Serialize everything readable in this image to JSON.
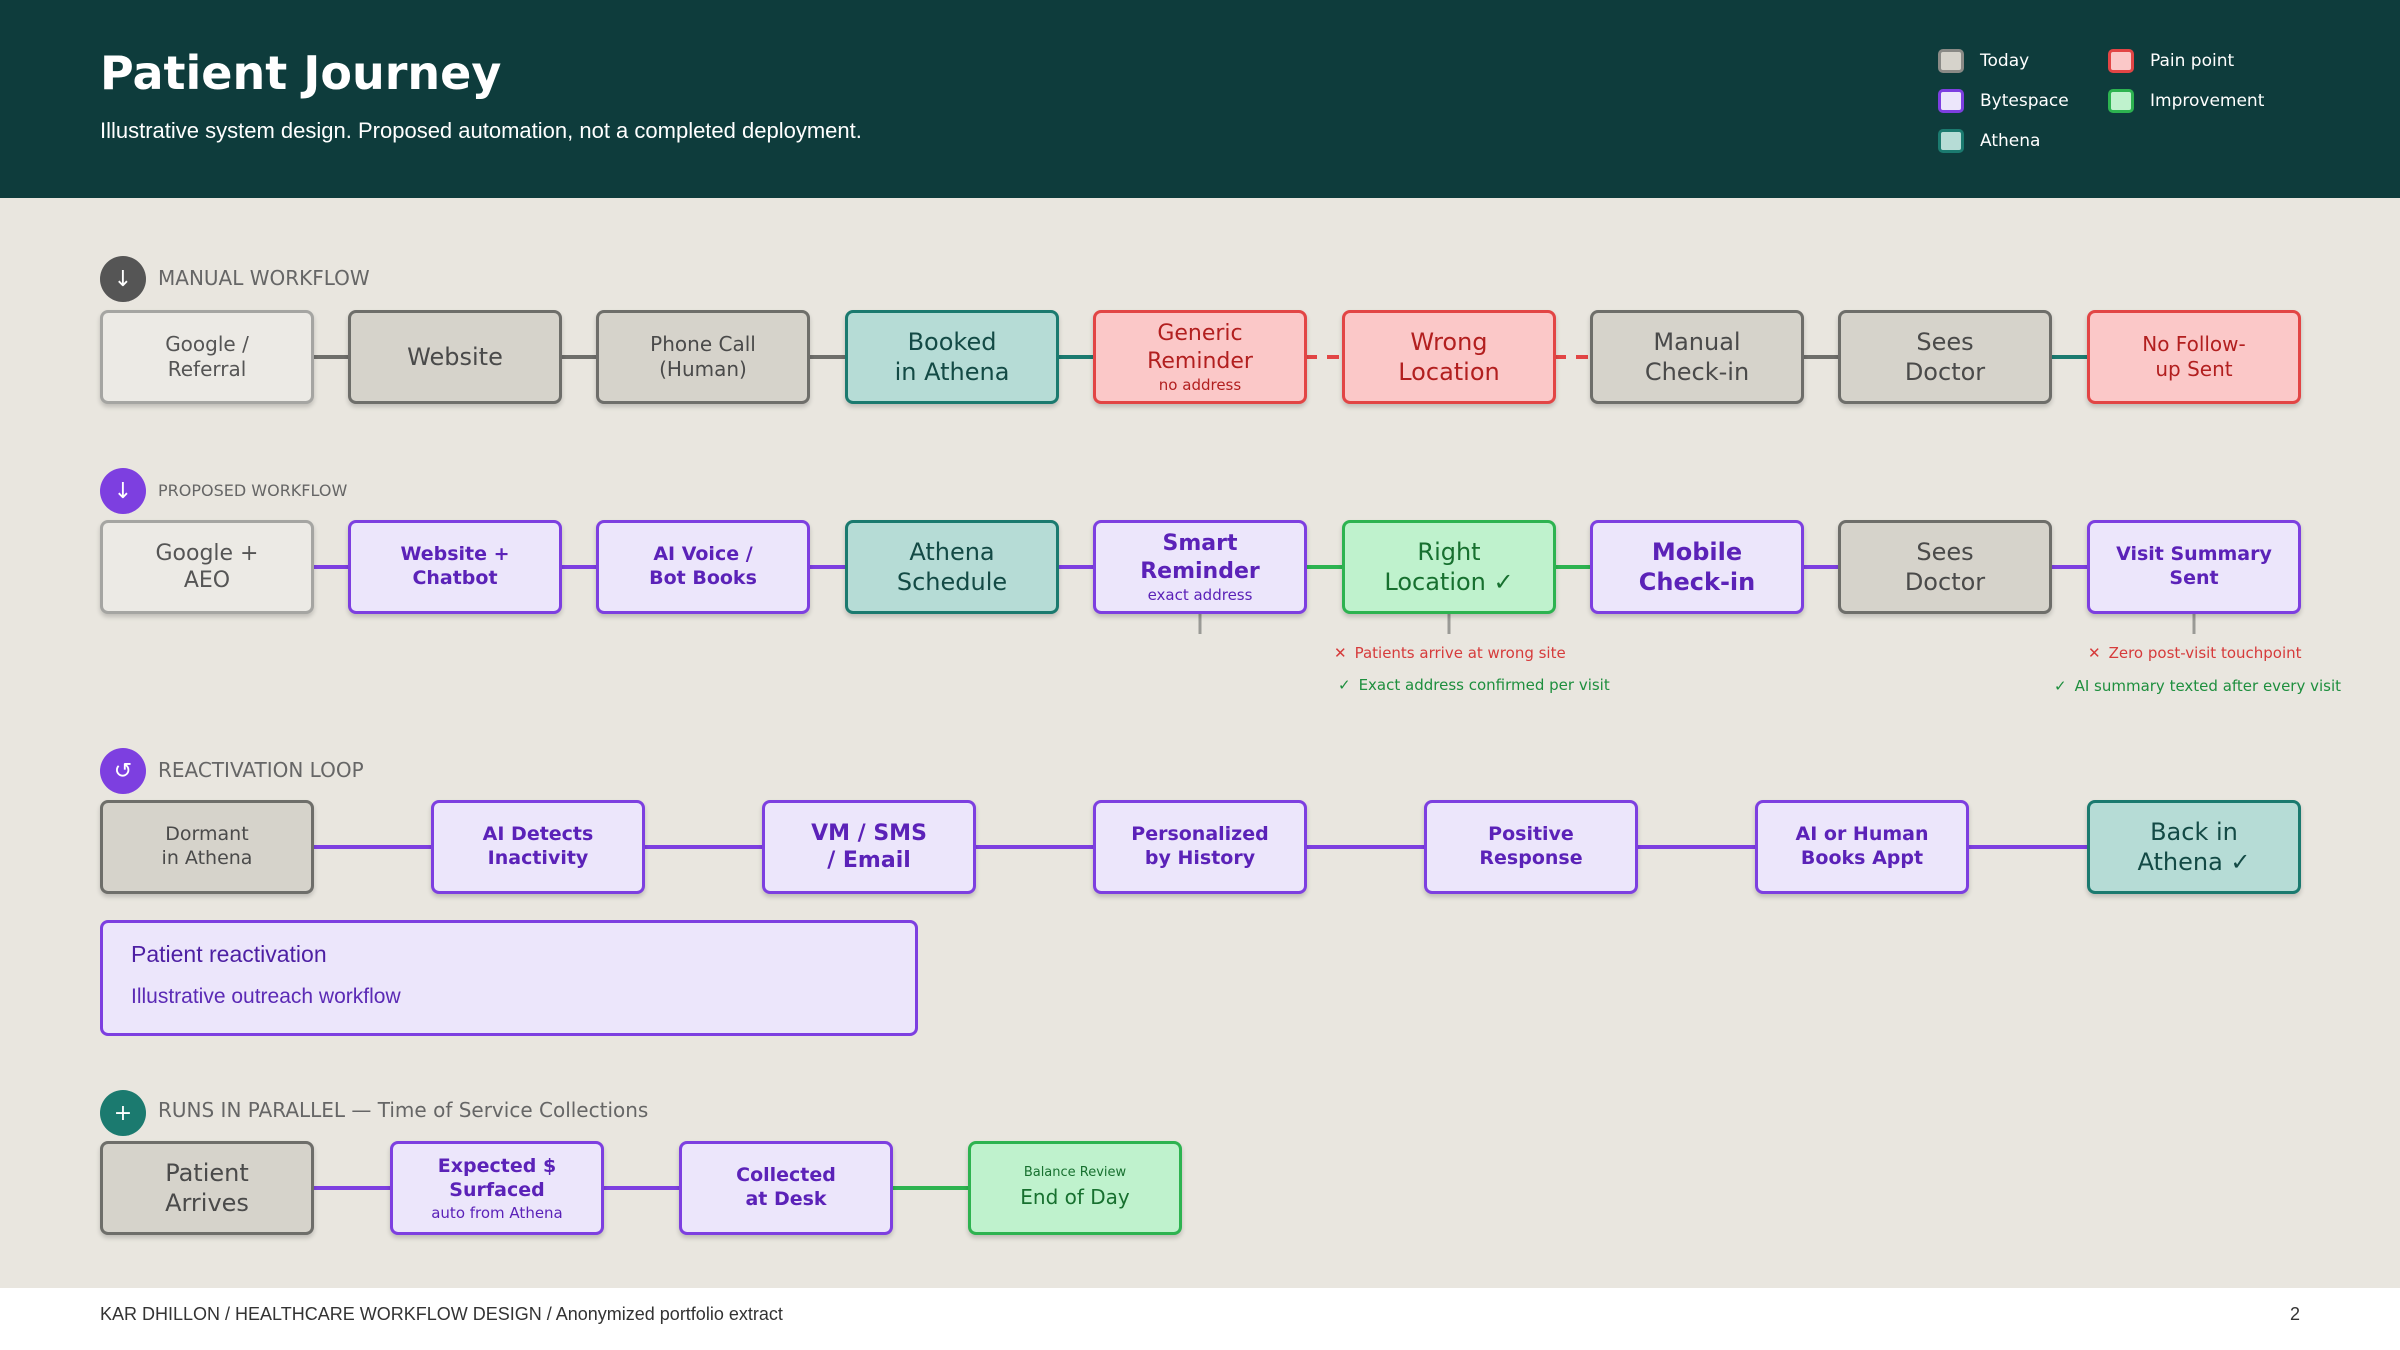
{
  "header": {
    "title": "Patient Journey",
    "subtitle": "Illustrative system design. Proposed automation, not a completed deployment."
  },
  "legend": [
    {
      "label": "Today",
      "fill": "#d6d3cb",
      "border": "#8a8a86"
    },
    {
      "label": "Pain point",
      "fill": "#fbc8c8",
      "border": "#e24545"
    },
    {
      "label": "Bytespace",
      "fill": "#ece6fb",
      "border": "#7d3fe0"
    },
    {
      "label": "Improvement",
      "fill": "#bff2cd",
      "border": "#2db350"
    },
    {
      "label": "Athena",
      "fill": "#b6dcd6",
      "border": "#1b7a6f"
    }
  ],
  "colors": {
    "header_bg": "#0e3c3c",
    "today_line": "#6e6e6a",
    "bytespace_line": "#7d3fe0",
    "athena_line": "#1b7a6f",
    "pain_line": "#e24545",
    "improve_line": "#2db350"
  },
  "sections": {
    "manual": {
      "label": "MANUAL WORKFLOW",
      "icon": "↓",
      "icon_name": "arrow-down-icon",
      "icon_color": "#555555"
    },
    "proposed": {
      "label": "PROPOSED WORKFLOW",
      "icon": "↓",
      "icon_name": "arrow-down-icon",
      "icon_color": "#7d3fe0"
    },
    "reactivation": {
      "label": "REACTIVATION LOOP",
      "icon": "↺",
      "icon_name": "loop-icon",
      "icon_color": "#7d3fe0"
    },
    "parallel": {
      "label": "RUNS IN PARALLEL — Time of Service Collections",
      "icon": "+",
      "icon_name": "plus-icon",
      "icon_color": "#1b7a6f"
    }
  },
  "manual_nodes": [
    {
      "label": "Google /\nReferral",
      "kind": "today-light"
    },
    {
      "label": "Website",
      "kind": "today"
    },
    {
      "label": "Phone Call\n(Human)",
      "kind": "today"
    },
    {
      "label": "Booked\nin Athena",
      "kind": "athena"
    },
    {
      "label": "Generic\nReminder",
      "note": "no address",
      "kind": "pain"
    },
    {
      "label": "Wrong\nLocation",
      "kind": "pain"
    },
    {
      "label": "Manual\nCheck-in",
      "kind": "today"
    },
    {
      "label": "Sees\nDoctor",
      "kind": "today"
    },
    {
      "label": "No Follow-\nup Sent",
      "kind": "pain"
    }
  ],
  "proposed_nodes": [
    {
      "label": "Google +\nAEO",
      "kind": "today-light"
    },
    {
      "label": "Website +\nChatbot",
      "kind": "bytespace"
    },
    {
      "label": "AI Voice /\nBot Books",
      "kind": "bytespace"
    },
    {
      "label": "Athena\nSchedule",
      "kind": "athena"
    },
    {
      "label": "Smart\nReminder",
      "note": "exact address",
      "kind": "bytespace"
    },
    {
      "label": "Right\nLocation ✓",
      "kind": "improve"
    },
    {
      "label": "Mobile\nCheck-in",
      "kind": "bytespace"
    },
    {
      "label": "Sees\nDoctor",
      "kind": "today"
    },
    {
      "label": "Visit Summary\nSent",
      "kind": "bytespace"
    }
  ],
  "annotations": {
    "location_problem": "Patients arrive at wrong site",
    "location_fix": "Exact address confirmed per visit",
    "followup_problem": "Zero post-visit touchpoint",
    "followup_fix": "AI summary texted after every visit",
    "bad_mark": "✕",
    "good_mark": "✓"
  },
  "reactivation_nodes": [
    {
      "label": "Dormant\nin Athena",
      "kind": "today"
    },
    {
      "label": "AI Detects\nInactivity",
      "kind": "bytespace"
    },
    {
      "label": "VM / SMS\n/ Email",
      "kind": "bytespace"
    },
    {
      "label": "Personalized\nby History",
      "kind": "bytespace"
    },
    {
      "label": "Positive\nResponse",
      "kind": "bytespace"
    },
    {
      "label": "AI or Human\nBooks Appt",
      "kind": "bytespace"
    },
    {
      "label": "Back in\nAthena ✓",
      "kind": "athena"
    }
  ],
  "reactivation_card": {
    "title": "Patient reactivation",
    "subtitle": "Illustrative outreach workflow"
  },
  "parallel_nodes": [
    {
      "label": "Patient\nArrives",
      "kind": "today"
    },
    {
      "label": "Expected $\nSurfaced",
      "note": "auto from Athena",
      "kind": "bytespace"
    },
    {
      "label": "Collected\nat Desk",
      "kind": "bytespace"
    },
    {
      "label": "End of Day",
      "pre": "Balance Review",
      "kind": "improve"
    }
  ],
  "footer": {
    "text": "KAR DHILLON / HEALTHCARE WORKFLOW DESIGN / Anonymized portfolio extract",
    "page": "2"
  }
}
